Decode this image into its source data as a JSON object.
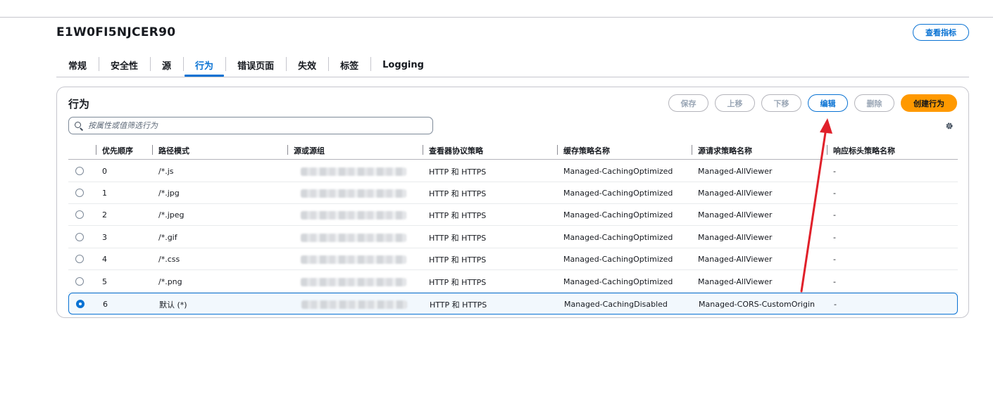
{
  "distribution": {
    "id": "E1W0FI5NJCER90"
  },
  "header": {
    "metrics_label": "查看指标"
  },
  "tabs": [
    {
      "label": "常规",
      "active": false
    },
    {
      "label": "安全性",
      "active": false
    },
    {
      "label": "源",
      "active": false
    },
    {
      "label": "行为",
      "active": true
    },
    {
      "label": "错误页面",
      "active": false
    },
    {
      "label": "失效",
      "active": false
    },
    {
      "label": "标签",
      "active": false
    },
    {
      "label": "Logging",
      "active": false
    }
  ],
  "panel": {
    "title": "行为",
    "buttons": {
      "save": "保存",
      "move_up": "上移",
      "move_down": "下移",
      "edit": "编辑",
      "delete": "删除",
      "create": "创建行为"
    },
    "search_placeholder": "按属性或值筛选行为"
  },
  "table": {
    "columns": [
      "优先顺序",
      "路径模式",
      "源或源组",
      "查看器协议策略",
      "缓存策略名称",
      "源请求策略名称",
      "响应标头策略名称"
    ],
    "rows": [
      {
        "precedence": "0",
        "path": "/*.js",
        "viewer": "HTTP 和 HTTPS",
        "cache": "Managed-CachingOptimized",
        "origin_request": "Managed-AllViewer",
        "response_headers": "-",
        "selected": false
      },
      {
        "precedence": "1",
        "path": "/*.jpg",
        "viewer": "HTTP 和 HTTPS",
        "cache": "Managed-CachingOptimized",
        "origin_request": "Managed-AllViewer",
        "response_headers": "-",
        "selected": false
      },
      {
        "precedence": "2",
        "path": "/*.jpeg",
        "viewer": "HTTP 和 HTTPS",
        "cache": "Managed-CachingOptimized",
        "origin_request": "Managed-AllViewer",
        "response_headers": "-",
        "selected": false
      },
      {
        "precedence": "3",
        "path": "/*.gif",
        "viewer": "HTTP 和 HTTPS",
        "cache": "Managed-CachingOptimized",
        "origin_request": "Managed-AllViewer",
        "response_headers": "-",
        "selected": false
      },
      {
        "precedence": "4",
        "path": "/*.css",
        "viewer": "HTTP 和 HTTPS",
        "cache": "Managed-CachingOptimized",
        "origin_request": "Managed-AllViewer",
        "response_headers": "-",
        "selected": false
      },
      {
        "precedence": "5",
        "path": "/*.png",
        "viewer": "HTTP 和 HTTPS",
        "cache": "Managed-CachingOptimized",
        "origin_request": "Managed-AllViewer",
        "response_headers": "-",
        "selected": false
      },
      {
        "precedence": "6",
        "path": "默认 (*)",
        "viewer": "HTTP 和 HTTPS",
        "cache": "Managed-CachingDisabled",
        "origin_request": "Managed-CORS-CustomOrigin",
        "response_headers": "-",
        "selected": true
      }
    ]
  },
  "colors": {
    "accent": "#0972d3",
    "primary_button": "#ff9900",
    "annotation_arrow": "#e0202a"
  },
  "icons": [
    "search-icon",
    "gear-icon",
    "radio-icon"
  ]
}
